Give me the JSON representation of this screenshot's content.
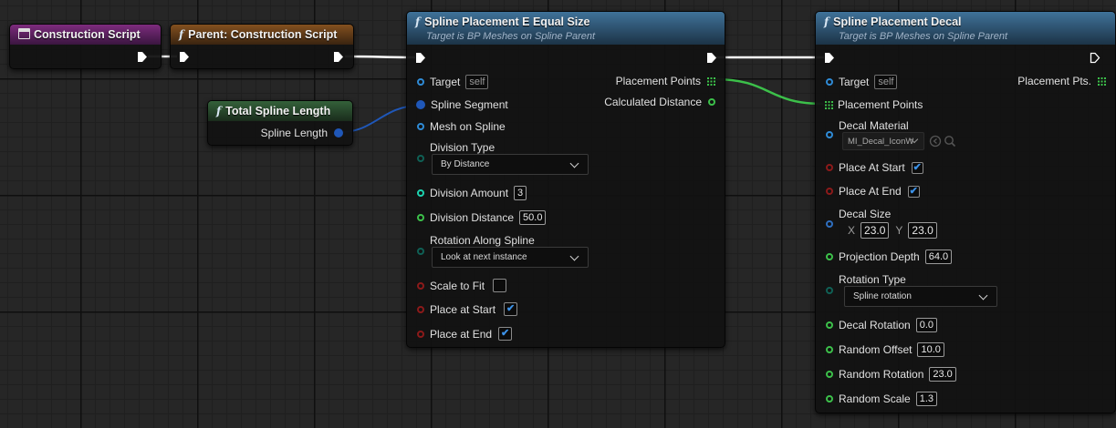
{
  "colors": {
    "exec_wire": "#ffffff",
    "struct_wire": "#1f57b8",
    "array_wire": "#3cc04a",
    "pin_float": "#3cc04a",
    "pin_int": "#1dd3b0",
    "pin_bool": "#8c1a1a",
    "pin_object": "#2f8bd6",
    "pin_enum": "#0f6055",
    "header_event": "#7a2a7a",
    "header_parent": "#7a4a1f",
    "header_pure": "#2f5a35",
    "header_function": "#3d6f95"
  },
  "nodes": {
    "construction_script": {
      "title": "Construction Script"
    },
    "parent_construction": {
      "icon": "f",
      "title": "Parent: Construction Script"
    },
    "total_spline_length": {
      "icon": "f",
      "title": "Total Spline Length",
      "output": "Spline Length"
    },
    "equal_size": {
      "icon": "f",
      "title": "Spline Placement E Equal Size",
      "subtitle": "Target is BP Meshes on Spline Parent",
      "target_label": "Target",
      "target_value": "self",
      "spline_segment": "Spline Segment",
      "mesh_on_spline": "Mesh on Spline",
      "division_type_label": "Division Type",
      "division_type_value": "By Distance",
      "division_amount_label": "Division Amount",
      "division_amount_value": "3",
      "division_distance_label": "Division Distance",
      "division_distance_value": "50.0",
      "rotation_label": "Rotation Along Spline",
      "rotation_value": "Look at next instance",
      "scale_to_fit": "Scale to Fit",
      "scale_to_fit_checked": false,
      "place_at_start": "Place at Start",
      "place_at_start_checked": true,
      "place_at_end": "Place at End",
      "place_at_end_checked": true,
      "out_placement_points": "Placement Points",
      "out_calculated_distance": "Calculated Distance"
    },
    "decal": {
      "icon": "f",
      "title": "Spline Placement Decal",
      "subtitle": "Target is BP Meshes on Spline Parent",
      "target_label": "Target",
      "target_value": "self",
      "placement_points": "Placement Points",
      "out_placement_pts": "Placement Pts.",
      "decal_material_label": "Decal Material",
      "decal_material_value": "MI_Decal_IconW",
      "place_at_start": "Place At Start",
      "place_at_start_checked": true,
      "place_at_end": "Place At End",
      "place_at_end_checked": true,
      "decal_size_label": "Decal Size",
      "x_label": "X",
      "x_value": "23.0",
      "y_label": "Y",
      "y_value": "23.0",
      "projection_depth_label": "Projection Depth",
      "projection_depth_value": "64.0",
      "rotation_type_label": "Rotation Type",
      "rotation_type_value": "Spline rotation",
      "decal_rotation_label": "Decal Rotation",
      "decal_rotation_value": "0.0",
      "random_offset_label": "Random Offset",
      "random_offset_value": "10.0",
      "random_rotation_label": "Random Rotation",
      "random_rotation_value": "23.0",
      "random_scale_label": "Random Scale",
      "random_scale_value": "1.3"
    }
  }
}
